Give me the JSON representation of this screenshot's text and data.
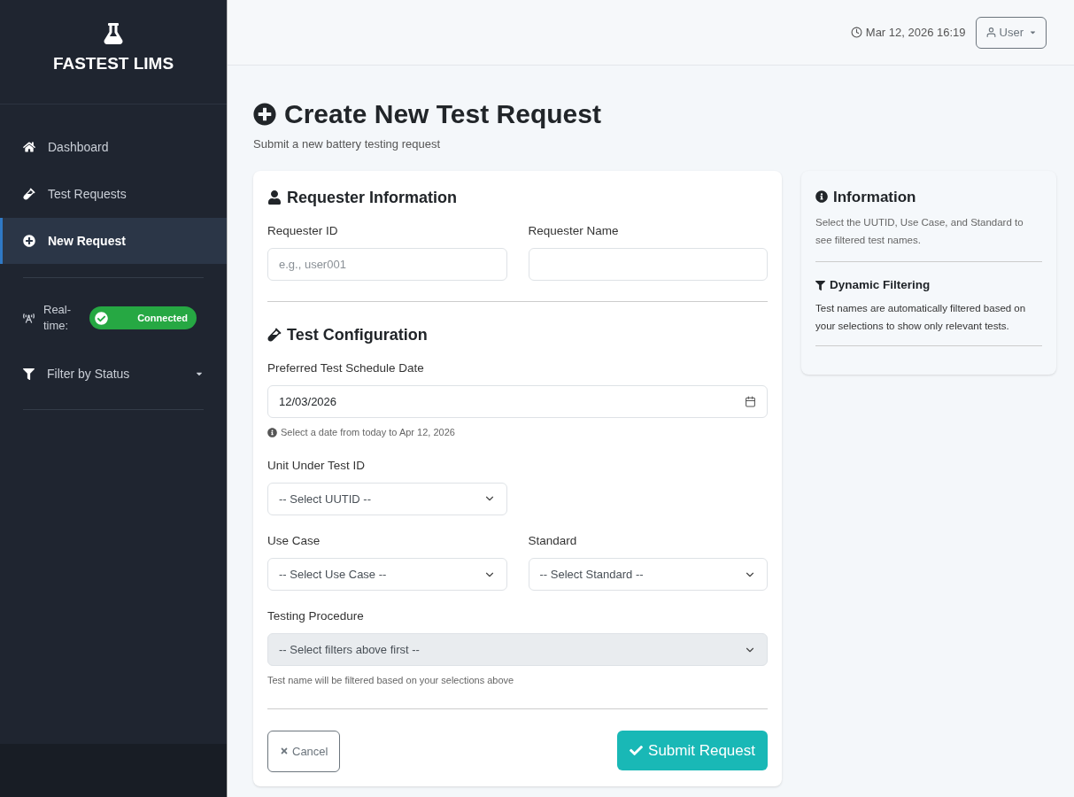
{
  "sidebar": {
    "brand": "FASTEST LIMS",
    "items": [
      {
        "label": "Dashboard",
        "selected": false
      },
      {
        "label": "Test Requests",
        "selected": false
      },
      {
        "label": "New Request",
        "selected": true
      }
    ],
    "realtime": {
      "label": "Real-time:",
      "status": "Connected",
      "connected": true
    },
    "filter": {
      "label": "Filter by Status",
      "expanded": false
    }
  },
  "header": {
    "datetime": "Mar 12, 2026 16:19",
    "user": "User"
  },
  "page": {
    "title": "Create New Test Request",
    "subtitle": "Submit a new battery testing request"
  },
  "form": {
    "sections": [
      {
        "title": "Requester Information",
        "rows": [
          [
            {
              "kind": "input",
              "label": "Requester ID",
              "placeholder": "e.g., user001"
            },
            {
              "kind": "input",
              "label": "Requester Name"
            }
          ]
        ]
      },
      {
        "title": "Test Configuration",
        "rows": [
          [
            {
              "kind": "date",
              "label": "Preferred Test Schedule Date",
              "value": "12/03/2026",
              "hint": "Select a date from today to Apr 12, 2026"
            }
          ],
          [
            {
              "kind": "select",
              "label": "Unit Under Test ID",
              "value": "-- Select UUTID --",
              "disabled": false
            },
            {
              "kind": "empty"
            }
          ],
          [
            {
              "kind": "select",
              "label": "Use Case",
              "value": "-- Select Use Case --",
              "disabled": false
            },
            {
              "kind": "select",
              "label": "Standard",
              "value": "-- Select Standard --",
              "disabled": false
            }
          ],
          [
            {
              "kind": "select",
              "label": "Testing Procedure",
              "value": "-- Select filters above first --",
              "disabled": true,
              "hint": "Test name will be filtered based on your selections above"
            }
          ]
        ]
      }
    ],
    "cancel": "Cancel",
    "submit": "Submit Request"
  },
  "info": {
    "title": "Information",
    "text": "Select the UUTID, Use Case, and Standard to see filtered test names.",
    "subtitle": "Dynamic Filtering",
    "subtext": "Test names are automatically filtered based on your selections to show only relevant tests."
  }
}
